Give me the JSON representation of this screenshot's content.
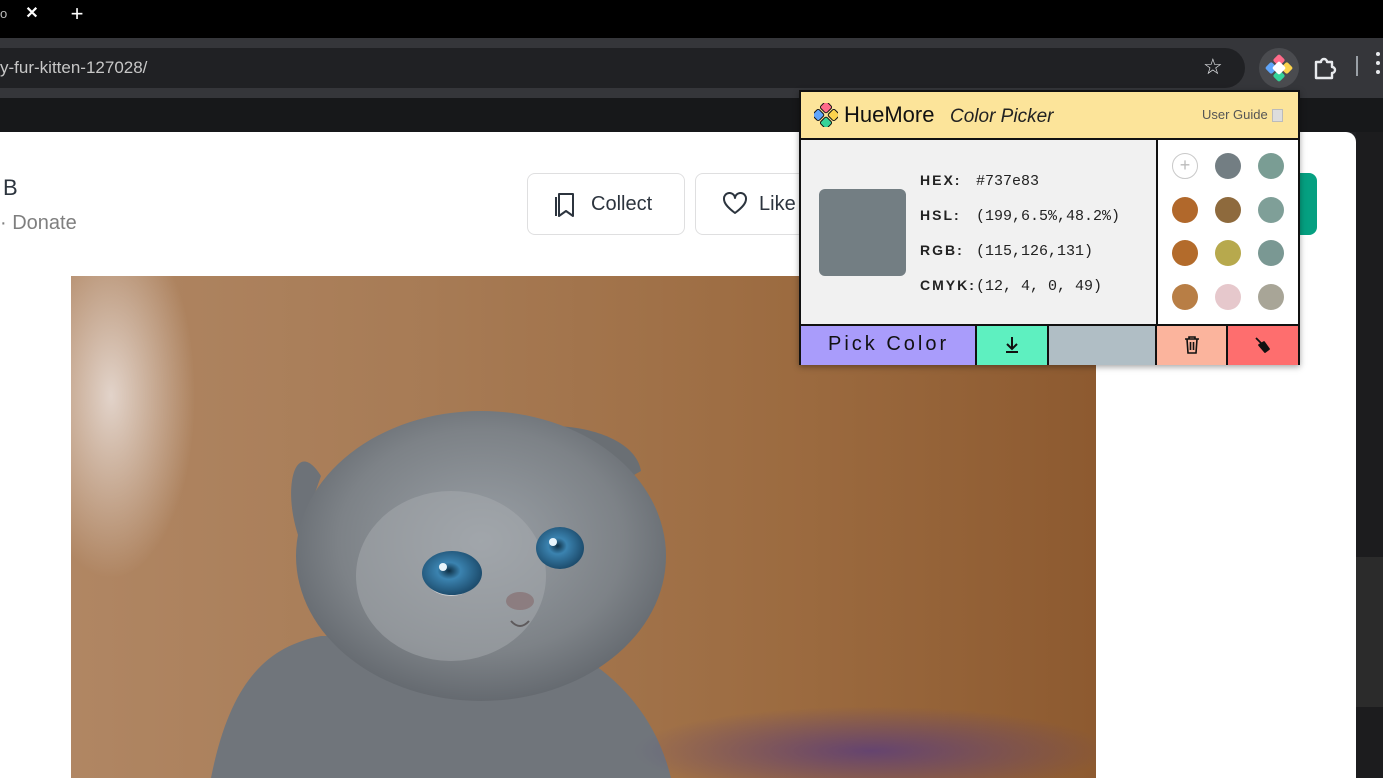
{
  "browser": {
    "tab_fragment": "o",
    "url": "y-fur-kitten-127028/"
  },
  "page": {
    "author": "B",
    "donate": "· Donate",
    "collect_label": "Collect",
    "like_label": "Like"
  },
  "extension": {
    "brand": "HueMore",
    "subtitle": "Color Picker",
    "user_guide": "User Guide",
    "current_color": "#737e83",
    "values": {
      "hex_label": "HEX:",
      "hex": "#737e83",
      "hsl_label": "HSL:",
      "hsl": "(199,6.5%,48.2%)",
      "rgb_label": "RGB:",
      "rgb": "(115,126,131)",
      "cmyk_label": "CMYK:",
      "cmyk": "(12, 4, 0, 49)"
    },
    "palette": [
      "#737e83",
      "#7a9d94",
      "#b1682b",
      "#8e6a3d",
      "#7f9f98",
      "#b36b2b",
      "#b7a94d",
      "#7a9893",
      "#b87e45",
      "#e6c8cc",
      "#a8a597"
    ],
    "pick_label": "Pick Color"
  }
}
